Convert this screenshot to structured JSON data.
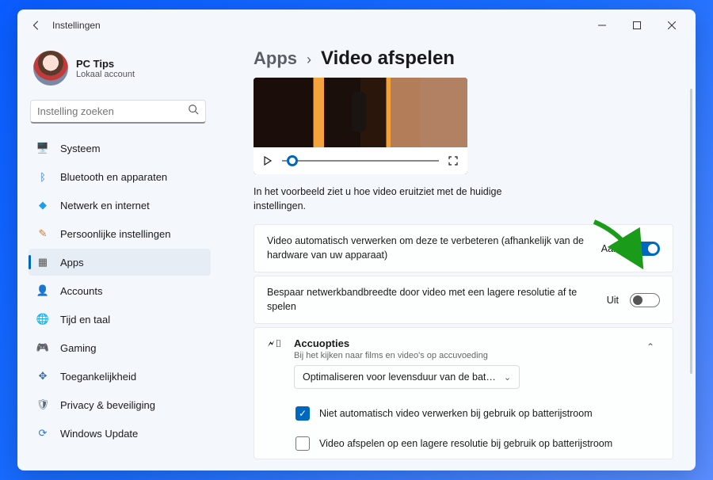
{
  "window": {
    "title": "Instellingen"
  },
  "profile": {
    "name": "PC Tips",
    "sub": "Lokaal account"
  },
  "search": {
    "placeholder": "Instelling zoeken"
  },
  "sidebar": {
    "items": [
      {
        "label": "Systeem",
        "icon": "🖥️",
        "color": "#1f6feb"
      },
      {
        "label": "Bluetooth en apparaten",
        "icon": "●",
        "color": "#1f6feb"
      },
      {
        "label": "Netwerk en internet",
        "icon": "◆",
        "color": "#1f9eeb"
      },
      {
        "label": "Persoonlijke instellingen",
        "icon": "✏",
        "color": "#d67a2a"
      },
      {
        "label": "Apps",
        "icon": "▦",
        "color": "#555"
      },
      {
        "label": "Accounts",
        "icon": "👤",
        "color": "#5fa06a"
      },
      {
        "label": "Tijd en taal",
        "icon": "🌐",
        "color": "#4a5aa0"
      },
      {
        "label": "Gaming",
        "icon": "🎮",
        "color": "#558a4a"
      },
      {
        "label": "Toegankelijkheid",
        "icon": "✥",
        "color": "#3a6aa5"
      },
      {
        "label": "Privacy & beveiliging",
        "icon": "🛡",
        "color": "#5a6a7a"
      },
      {
        "label": "Windows Update",
        "icon": "⟳",
        "color": "#1f7aeb"
      }
    ]
  },
  "breadcrumb": {
    "parent": "Apps",
    "current": "Video afspelen"
  },
  "preview_caption": "In het voorbeeld ziet u hoe video eruitziet met de huidige instellingen.",
  "settings": {
    "auto_enhance": {
      "text": "Video automatisch verwerken om deze te verbeteren (afhankelijk van de hardware van uw apparaat)",
      "state": "Aan"
    },
    "bandwidth": {
      "text": "Bespaar netwerkbandbreedte door video met een lagere resolutie af te spelen",
      "state": "Uit"
    }
  },
  "battery": {
    "title": "Accuopties",
    "sub": "Bij het kijken naar films en video's op accuvoeding",
    "dropdown": "Optimaliseren voor levensduur van de bat…",
    "check1": "Niet automatisch video verwerken bij gebruik op batterijstroom",
    "check2": "Video afspelen op een lagere resolutie bij gebruik op batterijstroom"
  }
}
